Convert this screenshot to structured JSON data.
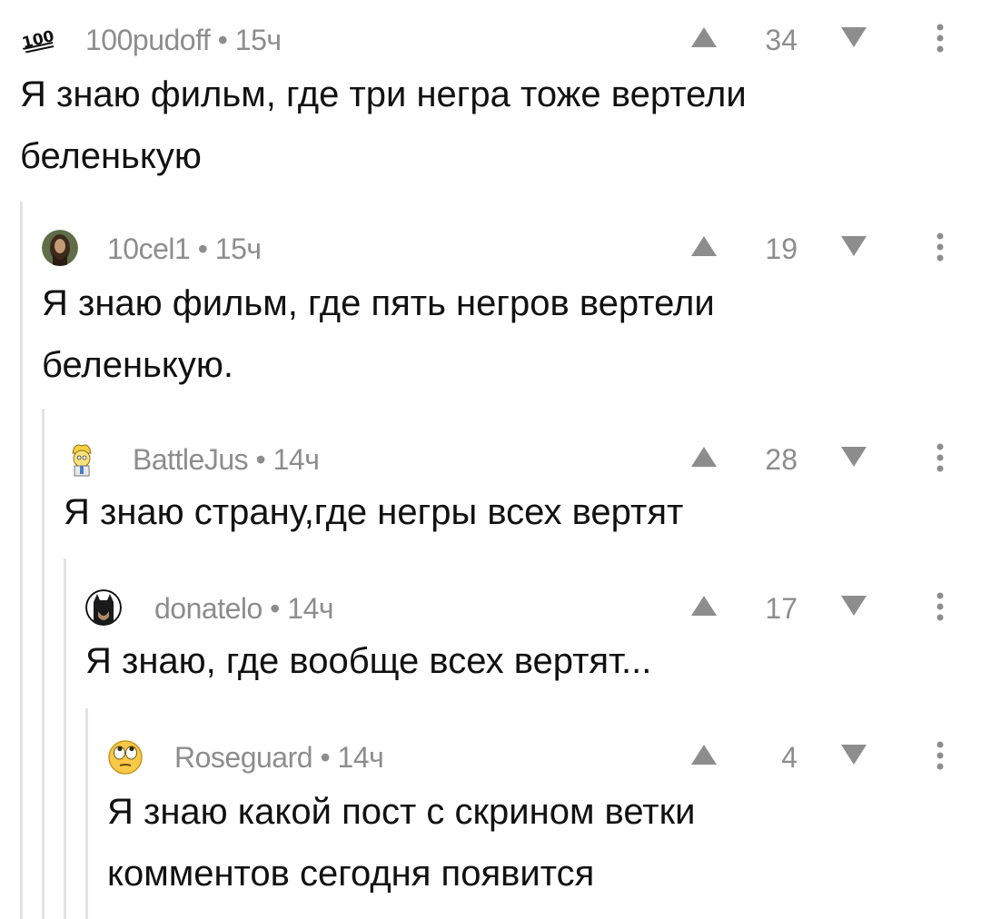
{
  "comments": [
    {
      "user": "100pudoff",
      "time": "15ч",
      "score": "34",
      "avatar_icon": "100-emoji-icon",
      "text": "Я знаю фильм, где три негра тоже вертели\nбеленькую"
    },
    {
      "user": "10cel1",
      "time": "15ч",
      "score": "19",
      "avatar_icon": "user-photo-icon",
      "text": "Я знаю фильм, где пять негров вертели\nбеленькую."
    },
    {
      "user": "BattleJus",
      "time": "14ч",
      "score": "28",
      "avatar_icon": "cartoon-character-icon",
      "text": "Я знаю страну,где негры всех вертят"
    },
    {
      "user": "donatelo",
      "time": "14ч",
      "score": "17",
      "avatar_icon": "batman-icon",
      "text": "Я знаю, где вообще всех вертят..."
    },
    {
      "user": "Roseguard",
      "time": "14ч",
      "score": "4",
      "avatar_icon": "rolling-eyes-emoji-icon",
      "text": "Я знаю какой пост с скрином ветки\nкомментов сегодня появится"
    }
  ],
  "meta_separator": "•",
  "colors": {
    "meta": "#8d8d8d",
    "thread_line": "#e3e3e3",
    "text": "#111111"
  }
}
